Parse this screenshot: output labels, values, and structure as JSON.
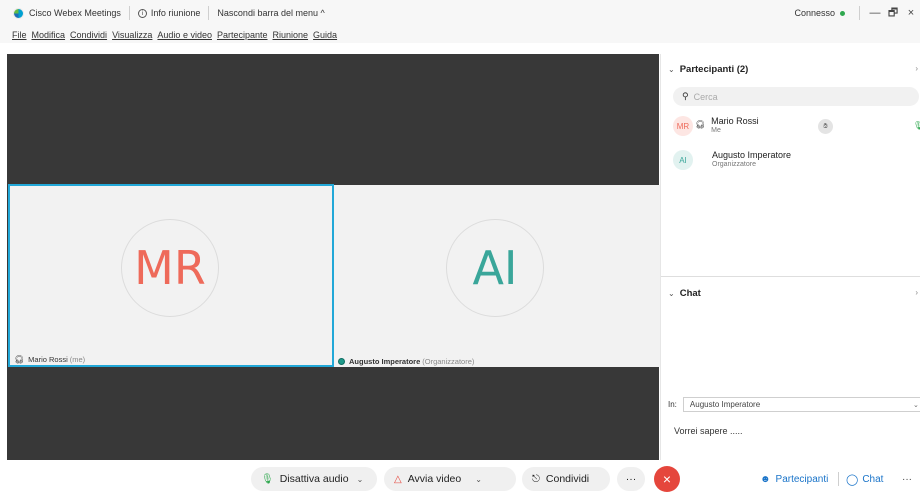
{
  "titlebar": {
    "app_title": "Cisco Webex Meetings",
    "info_label": "Info riunione",
    "hide_menu_label": "Nascondi barra del menu ^",
    "status": "Connesso",
    "minimize": "—",
    "restore": "🗗",
    "close": "×"
  },
  "menu": [
    "File",
    "Modifica",
    "Condividi",
    "Visualizza",
    "Audio e video",
    "Partecipante",
    "Riunione",
    "Guida"
  ],
  "videos": {
    "me": {
      "initials": "MR",
      "name": "Mario Rossi",
      "tag": "(me)"
    },
    "other": {
      "initials": "AI",
      "name": "Augusto Imperatore",
      "tag": "(Organizzatore)"
    }
  },
  "participants": {
    "header": "Partecipanti (2)",
    "search_placeholder": "Cerca",
    "list": [
      {
        "initials": "MR",
        "name": "Mario Rossi",
        "role": "Me"
      },
      {
        "initials": "AI",
        "name": "Augusto Imperatore",
        "role": "Organizzatore"
      }
    ]
  },
  "chat": {
    "header": "Chat",
    "in_label": "In:",
    "recipient": "Augusto Imperatore",
    "input_text": "Vorrei sapere ....."
  },
  "toolbar": {
    "mute": "Disattiva audio",
    "video": "Avvia video",
    "share": "Condividi",
    "more": "···",
    "end": "×",
    "participants": "Partecipanti",
    "chat": "Chat",
    "overflow": "···"
  },
  "colors": {
    "selected_tile_border": "#22a8d8",
    "end_button": "#e5463c",
    "link": "#1a74c9",
    "status_dot": "#2fa84f"
  }
}
